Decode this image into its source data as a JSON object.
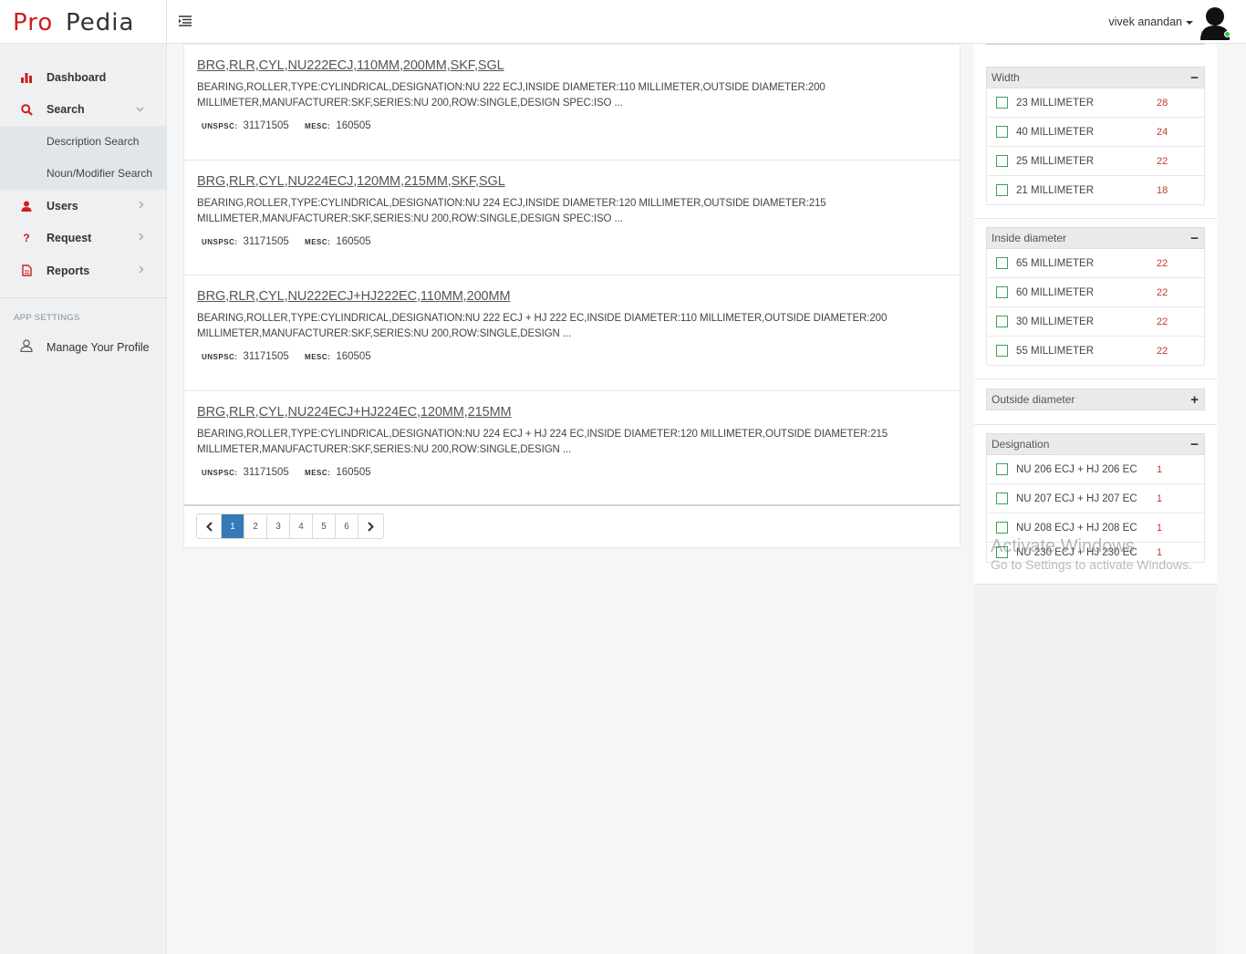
{
  "brand": {
    "logo_text": "ProPedia"
  },
  "sidebar": {
    "items": [
      {
        "label": "Dashboard"
      },
      {
        "label": "Search"
      },
      {
        "label": "Users"
      },
      {
        "label": "Request"
      },
      {
        "label": "Reports"
      }
    ],
    "search_sub": [
      {
        "label": "Description Search"
      },
      {
        "label": "Noun/Modifier Search"
      }
    ],
    "section_title": "APP SETTINGS",
    "profile_label": "Manage Your Profile"
  },
  "topbar": {
    "user_name": "vivek anandan"
  },
  "results": [
    {
      "title": "BRG,RLR,CYL,NU222ECJ,110MM,200MM,SKF,SGL",
      "description": "BEARING,ROLLER,TYPE:CYLINDRICAL,DESIGNATION:NU 222 ECJ,INSIDE DIAMETER:110 MILLIMETER,OUTSIDE DIAMETER:200 MILLIMETER,MANUFACTURER:SKF,SERIES:NU 200,ROW:SINGLE,DESIGN SPEC:ISO ...",
      "unspsc_label": "UNSPSC:",
      "unspsc": "31171505",
      "mesc_label": "MESC:",
      "mesc": "160505"
    },
    {
      "title": "BRG,RLR,CYL,NU224ECJ,120MM,215MM,SKF,SGL",
      "description": "BEARING,ROLLER,TYPE:CYLINDRICAL,DESIGNATION:NU 224 ECJ,INSIDE DIAMETER:120 MILLIMETER,OUTSIDE DIAMETER:215 MILLIMETER,MANUFACTURER:SKF,SERIES:NU 200,ROW:SINGLE,DESIGN SPEC:ISO ...",
      "unspsc_label": "UNSPSC:",
      "unspsc": "31171505",
      "mesc_label": "MESC:",
      "mesc": "160505"
    },
    {
      "title": "BRG,RLR,CYL,NU222ECJ+HJ222EC,110MM,200MM",
      "description": "BEARING,ROLLER,TYPE:CYLINDRICAL,DESIGNATION:NU 222 ECJ + HJ 222 EC,INSIDE DIAMETER:110 MILLIMETER,OUTSIDE DIAMETER:200 MILLIMETER,MANUFACTURER:SKF,SERIES:NU 200,ROW:SINGLE,DESIGN ...",
      "unspsc_label": "UNSPSC:",
      "unspsc": "31171505",
      "mesc_label": "MESC:",
      "mesc": "160505"
    },
    {
      "title": "BRG,RLR,CYL,NU224ECJ+HJ224EC,120MM,215MM",
      "description": "BEARING,ROLLER,TYPE:CYLINDRICAL,DESIGNATION:NU 224 ECJ + HJ 224 EC,INSIDE DIAMETER:120 MILLIMETER,OUTSIDE DIAMETER:215 MILLIMETER,MANUFACTURER:SKF,SERIES:NU 200,ROW:SINGLE,DESIGN ...",
      "unspsc_label": "UNSPSC:",
      "unspsc": "31171505",
      "mesc_label": "MESC:",
      "mesc": "160505"
    }
  ],
  "pagination": {
    "pages": [
      "1",
      "2",
      "3",
      "4",
      "5",
      "6"
    ],
    "current": "1"
  },
  "filters": {
    "width": {
      "title": "Width",
      "toggle": "−",
      "options": [
        {
          "label": "23 MILLIMETER",
          "count": "28"
        },
        {
          "label": "40 MILLIMETER",
          "count": "24"
        },
        {
          "label": "25 MILLIMETER",
          "count": "22"
        },
        {
          "label": "21 MILLIMETER",
          "count": "18"
        }
      ]
    },
    "inside_diameter": {
      "title": "Inside diameter",
      "toggle": "−",
      "options": [
        {
          "label": "65 MILLIMETER",
          "count": "22"
        },
        {
          "label": "60 MILLIMETER",
          "count": "22"
        },
        {
          "label": "30 MILLIMETER",
          "count": "22"
        },
        {
          "label": "55 MILLIMETER",
          "count": "22"
        }
      ]
    },
    "outside_diameter": {
      "title": "Outside diameter",
      "toggle": "+"
    },
    "designation": {
      "title": "Designation",
      "toggle": "−",
      "options": [
        {
          "label": "NU 206 ECJ + HJ 206 EC",
          "count": "1"
        },
        {
          "label": "NU 207 ECJ + HJ 207 EC",
          "count": "1"
        },
        {
          "label": "NU 208 ECJ + HJ 208 EC",
          "count": "1"
        },
        {
          "label": "NU 230 ECJ + HJ 230 EC",
          "count": "1"
        }
      ]
    }
  },
  "watermark": {
    "line1": "Activate Windows",
    "line2": "Go to Settings to activate Windows."
  },
  "colors": {
    "accent": "#cc1f1f",
    "page_active": "#337ab7",
    "checkbox": "#3aa05a",
    "count": "#c0392b"
  }
}
